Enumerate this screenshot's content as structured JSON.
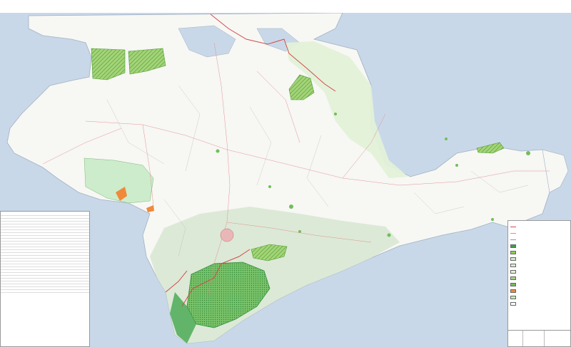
{
  "map": {
    "title_line_1": "",
    "title_line_2": "",
    "city_label": "",
    "colors": {
      "sea": "#c9d8e8",
      "land": "#f7f7f4",
      "forest": "#dce9d6",
      "protected_light": "#cdeccb",
      "protected_hatched": "#8fce4f",
      "protected_dark": "#3aa245",
      "wetland": "#e3f1d8",
      "border_red": "#d24b4b",
      "road": "#e08a8a",
      "orange_zone": "#f0893a"
    },
    "left_legend": {
      "title": "",
      "rows": 56
    },
    "right_legend": {
      "title": "",
      "entries": [
        {
          "kind": "line",
          "color": "#d24b4b",
          "text": ""
        },
        {
          "kind": "line",
          "color": "#e08a8a",
          "text": ""
        },
        {
          "kind": "line",
          "color": "#999999",
          "text": ""
        },
        {
          "kind": "fill",
          "color": "#3aa245",
          "text": ""
        },
        {
          "kind": "fill",
          "color": "#8fce4f",
          "text": ""
        },
        {
          "kind": "fill",
          "color": "#cdeccb",
          "text": ""
        },
        {
          "kind": "fill",
          "color": "#dce9d6",
          "text": ""
        },
        {
          "kind": "fill",
          "color": "#e3f1d8",
          "text": ""
        },
        {
          "kind": "fill",
          "color": "#a6d37a",
          "text": ""
        },
        {
          "kind": "fill",
          "color": "#6fbf5a",
          "text": ""
        },
        {
          "kind": "fill",
          "color": "#f0893a",
          "text": ""
        },
        {
          "kind": "fill",
          "color": "#c6e6b5",
          "text": ""
        },
        {
          "kind": "fill",
          "color": "#ffffff",
          "text": ""
        }
      ]
    }
  }
}
